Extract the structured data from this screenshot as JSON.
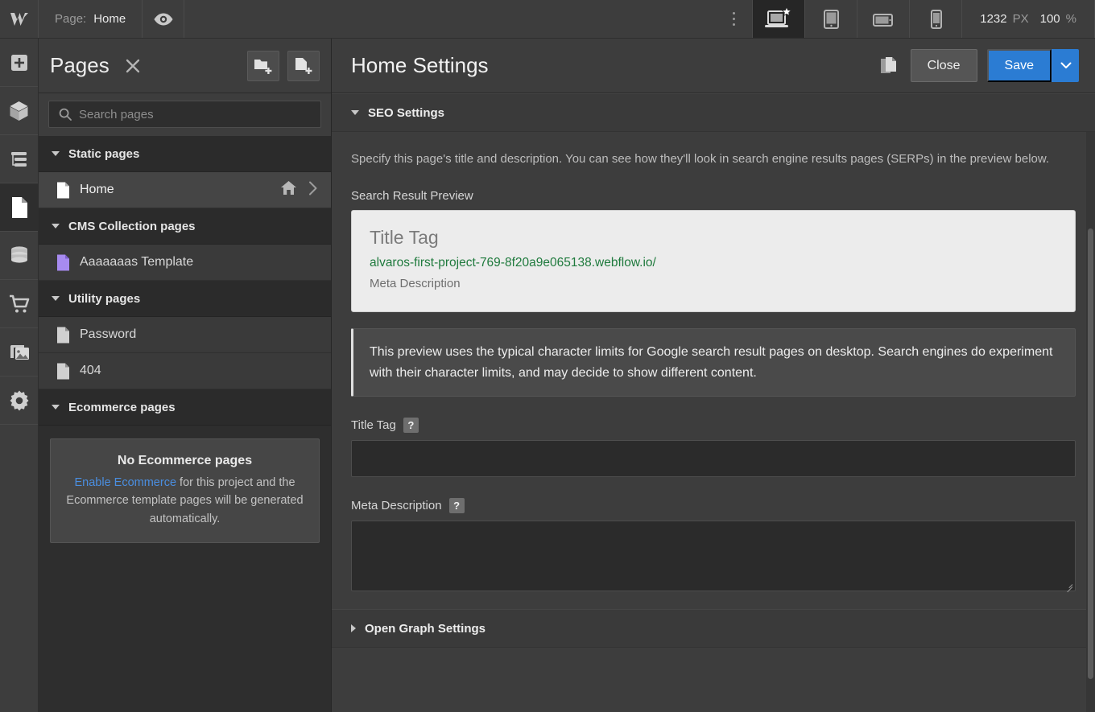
{
  "topbar": {
    "logo_icon": "webflow-logo-icon",
    "page_label": "Page:",
    "page_name": "Home",
    "preview_icon": "eye-icon",
    "kebab_icon": "more-vertical-icon",
    "breakpoints": [
      {
        "name": "desktop-breakpoint",
        "icon": "laptop-star-icon",
        "active": true
      },
      {
        "name": "tablet-breakpoint",
        "icon": "tablet-icon",
        "active": false
      },
      {
        "name": "mobile-landscape-breakpoint",
        "icon": "mobile-landscape-icon",
        "active": false
      },
      {
        "name": "mobile-portrait-breakpoint",
        "icon": "mobile-portrait-icon",
        "active": false
      }
    ],
    "canvas_width": "1232",
    "canvas_width_unit": "PX",
    "zoom_value": "100",
    "zoom_unit": "%"
  },
  "rail": {
    "items": [
      {
        "name": "add-elements",
        "icon": "plus-square-icon",
        "active": false
      },
      {
        "name": "components",
        "icon": "cube-icon",
        "active": false
      },
      {
        "name": "navigator",
        "icon": "navigator-layers-icon",
        "active": false
      },
      {
        "name": "pages",
        "icon": "page-document-icon",
        "active": true
      },
      {
        "name": "cms",
        "icon": "database-icon",
        "active": false
      },
      {
        "name": "ecommerce",
        "icon": "shopping-cart-icon",
        "active": false
      },
      {
        "name": "assets",
        "icon": "images-icon",
        "active": false
      },
      {
        "name": "settings",
        "icon": "gear-icon",
        "active": false
      }
    ]
  },
  "pages_panel": {
    "title": "Pages",
    "close_icon": "close-x-icon",
    "new_folder_icon": "new-folder-icon",
    "new_page_icon": "new-page-icon",
    "search": {
      "placeholder": "Search pages",
      "value": "",
      "icon": "search-icon"
    },
    "groups": [
      {
        "label": "Static pages",
        "items": [
          {
            "label": "Home",
            "icon": "page-icon",
            "icon_color": "#ffffff",
            "selected": true,
            "home_icon": "home-icon",
            "chevron_icon": "chevron-right-icon"
          }
        ]
      },
      {
        "label": "CMS Collection pages",
        "items": [
          {
            "label": "Aaaaaaas Template",
            "icon": "page-icon",
            "icon_color": "#a78bf0",
            "selected": false
          }
        ]
      },
      {
        "label": "Utility pages",
        "items": [
          {
            "label": "Password",
            "icon": "page-icon",
            "icon_color": "#d0d0d0",
            "selected": false
          },
          {
            "label": "404",
            "icon": "page-icon",
            "icon_color": "#d0d0d0",
            "selected": false
          }
        ]
      },
      {
        "label": "Ecommerce pages",
        "items": []
      }
    ],
    "empty_ecommerce": {
      "title": "No Ecommerce pages",
      "link_text": "Enable Ecommerce",
      "rest_text": " for this project and the Ecommerce template pages will be generated automatically."
    }
  },
  "settings_panel": {
    "title": "Home Settings",
    "duplicate_icon": "duplicate-pages-icon",
    "close_label": "Close",
    "save_label": "Save",
    "save_caret_icon": "chevron-down-icon",
    "sections": {
      "seo": {
        "label": "SEO Settings",
        "expanded": true,
        "description": "Specify this page's title and description. You can see how they'll look in search engine results pages (SERPs) in the preview below.",
        "preview_label": "Search Result Preview",
        "serp": {
          "title": "Title Tag",
          "url": "alvaros-first-project-769-8f20a9e065138.webflow.io/",
          "description": "Meta Description"
        },
        "callout": "This preview uses the typical character limits for Google search result pages on desktop. Search engines do experiment with their character limits, and may decide to show different content.",
        "title_tag": {
          "label": "Title Tag",
          "help_icon": "question-mark-icon",
          "value": ""
        },
        "meta_description": {
          "label": "Meta Description",
          "help_icon": "question-mark-icon",
          "value": ""
        }
      },
      "open_graph": {
        "label": "Open Graph Settings",
        "expanded": false
      }
    }
  },
  "colors": {
    "accent_blue": "#2b7cd3",
    "link_blue": "#4a8ee0",
    "serp_url_green": "#1f7a3d",
    "cms_purple": "#a78bf0",
    "panel_bg": "#3d3d3d",
    "panel_dark": "#2e2e2e"
  }
}
